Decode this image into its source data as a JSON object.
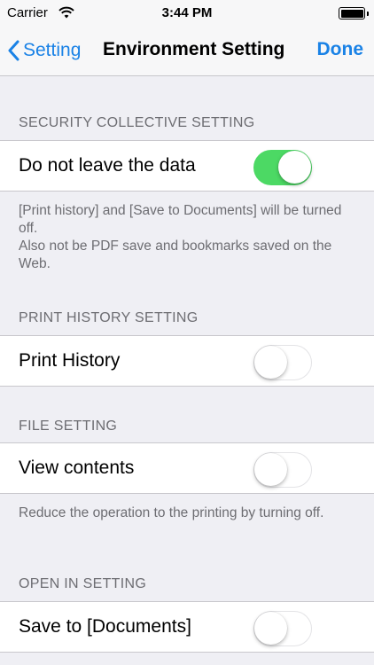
{
  "status_bar": {
    "carrier": "Carrier",
    "time": "3:44 PM"
  },
  "nav": {
    "back_label": "Setting",
    "title": "Environment Setting",
    "done_label": "Done"
  },
  "sections": {
    "security": {
      "header": "SECURITY COLLECTIVE SETTING",
      "row_label": "Do not leave the data",
      "toggle_on": true,
      "footnote_line1": "[Print history] and [Save to Documents] will be turned off.",
      "footnote_line2": "Also not be PDF save and bookmarks saved on the Web."
    },
    "print_history": {
      "header": "PRINT HISTORY SETTING",
      "row_label": "Print History",
      "toggle_on": false
    },
    "file": {
      "header": "FILE SETTING",
      "row_label": "View contents",
      "toggle_on": false,
      "footnote": "Reduce the operation to the printing by turning off."
    },
    "open_in": {
      "header": "OPEN IN SETTING",
      "row_label": "Save to [Documents]",
      "toggle_on": false
    }
  },
  "colors": {
    "accent": "#1a82e6",
    "toggle_on": "#4cd964",
    "background": "#efeff4"
  }
}
